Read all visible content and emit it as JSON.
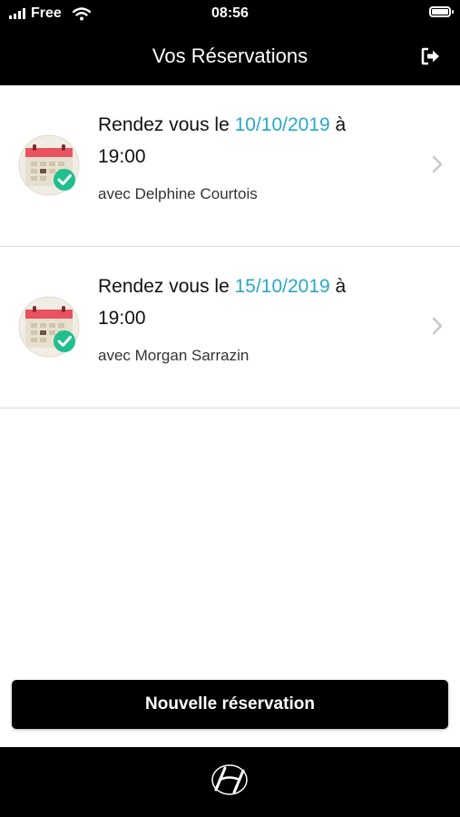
{
  "status_bar": {
    "carrier": "Free",
    "time": "08:56",
    "icons": [
      "signal-icon",
      "wifi-icon",
      "battery-icon"
    ]
  },
  "header": {
    "title": "Vos Réservations",
    "logout_icon": "logout-icon"
  },
  "reservations": [
    {
      "prefix": "Rendez vous le ",
      "date": "10/10/2019",
      "suffix": " à 19:00",
      "with": "avec Delphine Courtois",
      "icon": "calendar-check-icon"
    },
    {
      "prefix": "Rendez vous le ",
      "date": "15/10/2019",
      "suffix": " à 19:00",
      "with": "avec Morgan Sarrazin",
      "icon": "calendar-check-icon"
    }
  ],
  "actions": {
    "new_reservation": "Nouvelle réservation"
  },
  "colors": {
    "date_accent": "#28a9c7",
    "bars": "#000000",
    "calendar_red": "#e9525f",
    "check_green": "#1fbf8f"
  }
}
